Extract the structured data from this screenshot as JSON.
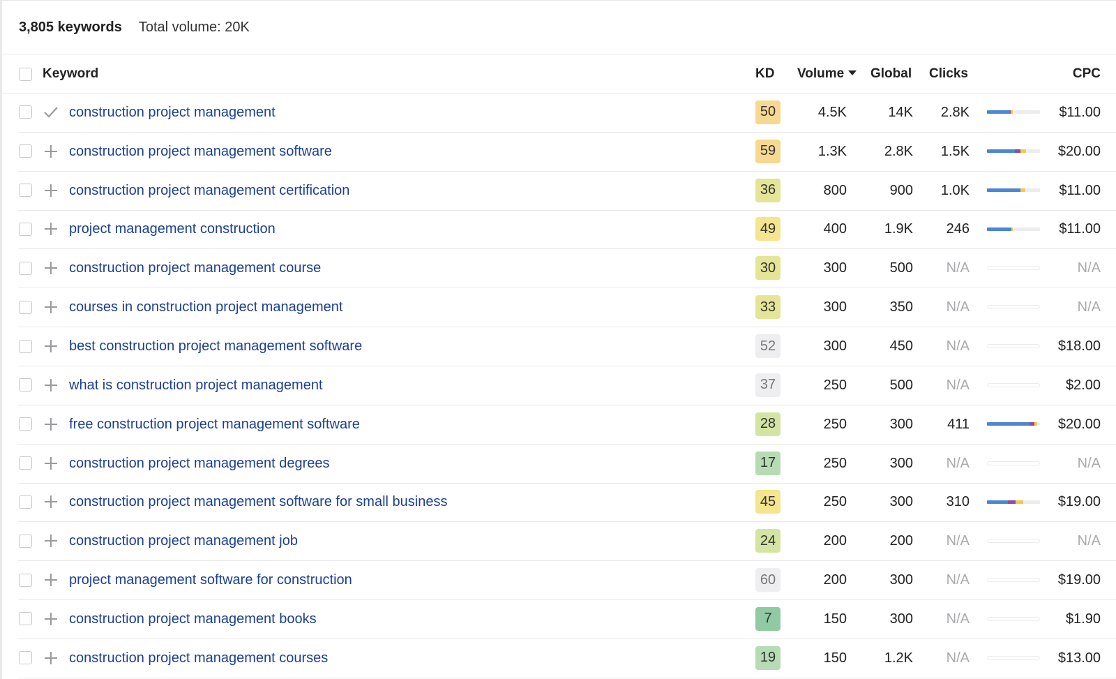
{
  "summary": {
    "count": "3,805 keywords",
    "total_volume": "Total volume: 20K"
  },
  "columns": {
    "keyword": "Keyword",
    "kd": "KD",
    "volume": "Volume",
    "global": "Global",
    "clicks": "Clicks",
    "cpc": "CPC"
  },
  "sort": {
    "column": "volume",
    "direction": "desc",
    "icon": "caret-down-icon"
  },
  "colors": {
    "link": "#1c3f94",
    "bar_blue": "#4a86d4",
    "bar_purple": "#8e4aa8",
    "bar_yellow": "#f2c94c",
    "bar_bg": "#ececee",
    "kd_orange": "#f7d891",
    "kd_yellow": "#f4e58e",
    "kd_yellowgreen": "#e4e596",
    "kd_lightgreen": "#d4e4a3",
    "kd_green": "#b5dcb3",
    "kd_darkgreen": "#8fcaa3",
    "kd_grey": "#eeeef0"
  },
  "rows": [
    {
      "keyword": "construction project management",
      "action": "check",
      "kd": "50",
      "kd_color": "#f7d891",
      "kd_muted": false,
      "volume": "4.5K",
      "global": "14K",
      "clicks": "2.8K",
      "clicks_na": false,
      "bar": [
        0.43,
        0.02,
        0.04
      ],
      "cpc": "$11.00",
      "cpc_na": false
    },
    {
      "keyword": "construction project management software",
      "action": "add",
      "kd": "59",
      "kd_color": "#f7d891",
      "kd_muted": false,
      "volume": "1.3K",
      "global": "2.8K",
      "clicks": "1.5K",
      "clicks_na": false,
      "bar": [
        0.52,
        0.11,
        0.11
      ],
      "cpc": "$20.00",
      "cpc_na": false
    },
    {
      "keyword": "construction project management certification",
      "action": "add",
      "kd": "36",
      "kd_color": "#e4e596",
      "kd_muted": false,
      "volume": "800",
      "global": "900",
      "clicks": "1.0K",
      "clicks_na": false,
      "bar": [
        0.63,
        0.0,
        0.1
      ],
      "cpc": "$11.00",
      "cpc_na": false
    },
    {
      "keyword": "project management construction",
      "action": "add",
      "kd": "49",
      "kd_color": "#f4e58e",
      "kd_muted": false,
      "volume": "400",
      "global": "1.9K",
      "clicks": "246",
      "clicks_na": false,
      "bar": [
        0.46,
        0.0,
        0.03
      ],
      "cpc": "$11.00",
      "cpc_na": false
    },
    {
      "keyword": "construction project management course",
      "action": "add",
      "kd": "30",
      "kd_color": "#e4e596",
      "kd_muted": false,
      "volume": "300",
      "global": "500",
      "clicks": "N/A",
      "clicks_na": true,
      "bar": null,
      "cpc": "N/A",
      "cpc_na": true
    },
    {
      "keyword": "courses in construction project management",
      "action": "add",
      "kd": "33",
      "kd_color": "#e4e596",
      "kd_muted": false,
      "volume": "300",
      "global": "350",
      "clicks": "N/A",
      "clicks_na": true,
      "bar": null,
      "cpc": "N/A",
      "cpc_na": true
    },
    {
      "keyword": "best construction project management software",
      "action": "add",
      "kd": "52",
      "kd_color": "#eeeef0",
      "kd_muted": true,
      "volume": "300",
      "global": "450",
      "clicks": "N/A",
      "clicks_na": true,
      "bar": null,
      "cpc": "$18.00",
      "cpc_na": false
    },
    {
      "keyword": "what is construction project management",
      "action": "add",
      "kd": "37",
      "kd_color": "#eeeef0",
      "kd_muted": true,
      "volume": "250",
      "global": "500",
      "clicks": "N/A",
      "clicks_na": true,
      "bar": null,
      "cpc": "$2.00",
      "cpc_na": false
    },
    {
      "keyword": "free construction project management software",
      "action": "add",
      "kd": "28",
      "kd_color": "#d4e4a3",
      "kd_muted": false,
      "volume": "250",
      "global": "300",
      "clicks": "411",
      "clicks_na": false,
      "bar": [
        0.8,
        0.1,
        0.05
      ],
      "cpc": "$20.00",
      "cpc_na": false
    },
    {
      "keyword": "construction project management degrees",
      "action": "add",
      "kd": "17",
      "kd_color": "#b5dcb3",
      "kd_muted": false,
      "volume": "250",
      "global": "300",
      "clicks": "N/A",
      "clicks_na": true,
      "bar": null,
      "cpc": "N/A",
      "cpc_na": true
    },
    {
      "keyword": "construction project management software for small business",
      "action": "add",
      "kd": "45",
      "kd_color": "#f4e58e",
      "kd_muted": false,
      "volume": "250",
      "global": "300",
      "clicks": "310",
      "clicks_na": false,
      "bar": [
        0.4,
        0.14,
        0.14
      ],
      "cpc": "$19.00",
      "cpc_na": false
    },
    {
      "keyword": "construction project management job",
      "action": "add",
      "kd": "24",
      "kd_color": "#d4e4a3",
      "kd_muted": false,
      "volume": "200",
      "global": "200",
      "clicks": "N/A",
      "clicks_na": true,
      "bar": null,
      "cpc": "N/A",
      "cpc_na": true
    },
    {
      "keyword": "project management software for construction",
      "action": "add",
      "kd": "60",
      "kd_color": "#eeeef0",
      "kd_muted": true,
      "volume": "200",
      "global": "300",
      "clicks": "N/A",
      "clicks_na": true,
      "bar": null,
      "cpc": "$19.00",
      "cpc_na": false
    },
    {
      "keyword": "construction project management books",
      "action": "add",
      "kd": "7",
      "kd_color": "#8fcaa3",
      "kd_muted": false,
      "volume": "150",
      "global": "300",
      "clicks": "N/A",
      "clicks_na": true,
      "bar": null,
      "cpc": "$1.90",
      "cpc_na": false
    },
    {
      "keyword": "construction project management courses",
      "action": "add",
      "kd": "19",
      "kd_color": "#b5dcb3",
      "kd_muted": false,
      "volume": "150",
      "global": "1.2K",
      "clicks": "N/A",
      "clicks_na": true,
      "bar": null,
      "cpc": "$13.00",
      "cpc_na": false
    }
  ]
}
